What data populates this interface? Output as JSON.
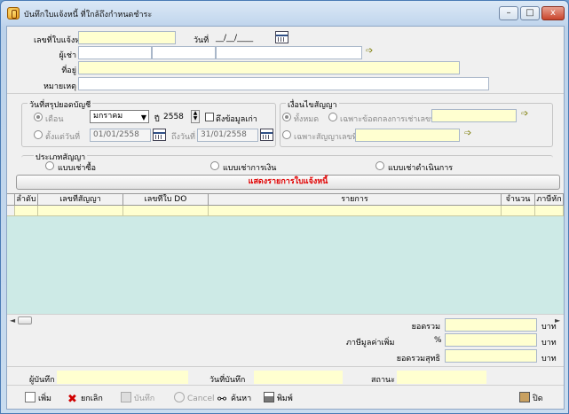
{
  "window": {
    "title": "บันทึกใบแจ้งหนี้ ที่ใกล้ถึงกำหนดชำระ",
    "minimize": "–",
    "maximize": "□",
    "close": "x"
  },
  "header_form": {
    "invoice_no_label": "เลขที่ใบแจ้งหนี้",
    "invoice_no_value": "",
    "date_label": "วันที่",
    "date_value": "__/__/____",
    "tenant_label": "ผู้เช่า",
    "address_label": "ที่อยู่",
    "remark_label": "หมายเหตุ"
  },
  "account_group": {
    "title": "วันที่สรุปยอดบัญชี",
    "month_option": "เดือน",
    "month_value": "มกราคม",
    "year_label": "ปี",
    "year_value": "2558",
    "pull_old_label": "ดึงข้อมูลเก่า",
    "from_date_option": "ตั้งแต่วันที่",
    "from_date_value": "01/01/2558",
    "to_date_label": "ถึงวันที่",
    "to_date_value": "31/01/2558"
  },
  "contract_filter": {
    "title": "เงื่อนไขสัญญา",
    "all_option": "ทั้งหมด",
    "by_agreement_option": "เฉพาะข้อตกลงการเช่าเลขที่",
    "by_contract_option": "เฉพาะสัญญาเลขที่"
  },
  "contract_type": {
    "title": "ประเภทสัญญา",
    "option1": "แบบเช่าซื้อ",
    "option2": "แบบเช่าการเงิน",
    "option3": "แบบเช่าดำเนินการ"
  },
  "show_invoice_button": "แสดงรายการใบแจ้งหนี้",
  "grid": {
    "columns": [
      "ลำดับ",
      "เลขที่สัญญา",
      "เลขที่ใบ DO",
      "รายการ",
      "จำนวน",
      "ภาษีหัก"
    ]
  },
  "totals": {
    "total_label": "ยอดรวม",
    "vat_label": "ภาษีมูลค่าเพิ่ม",
    "vat_percent": "%",
    "net_label": "ยอดรวมสุทธิ",
    "unit": "บาท"
  },
  "footer": {
    "recorder_label": "ผู้บันทึก",
    "record_date_label": "วันที่บันทึก",
    "status_label": "สถานะ"
  },
  "toolbar": {
    "add": "เพิ่ม",
    "cancel_doc": "ยกเลิก",
    "save": "บันทึก",
    "cancel": "Cancel",
    "search": "ค้นหา",
    "print": "พิมพ์",
    "close": "ปิด"
  }
}
